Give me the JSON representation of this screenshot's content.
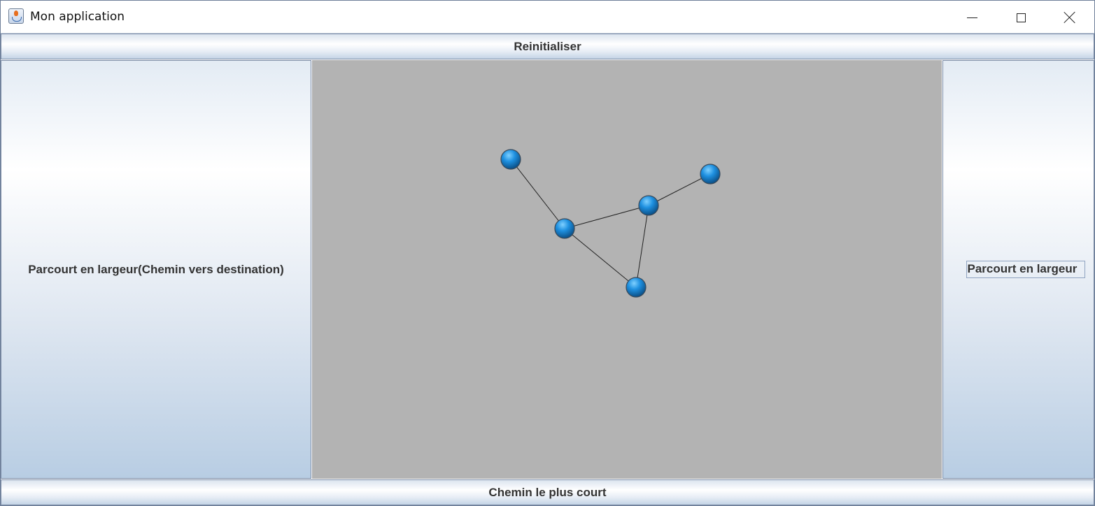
{
  "window": {
    "title": "Mon application",
    "controls": [
      "minimize-icon",
      "maximize-icon",
      "close-icon"
    ]
  },
  "buttons": {
    "top": "Reinitialiser",
    "left": "Parcourt en largeur(Chemin vers destination)",
    "right": "Parcourt en largeur",
    "bottom": "Chemin le plus court"
  },
  "graph": {
    "node_color": "#1e90e0",
    "edge_color": "#222222",
    "canvas_color": "#b3b3b3",
    "nodes": [
      {
        "id": "n1"
      },
      {
        "id": "n2"
      },
      {
        "id": "n3"
      },
      {
        "id": "n4"
      },
      {
        "id": "n5"
      }
    ],
    "edges": [
      [
        "n1",
        "n2"
      ],
      [
        "n2",
        "n3"
      ],
      [
        "n3",
        "n4"
      ],
      [
        "n2",
        "n5"
      ],
      [
        "n3",
        "n5"
      ]
    ]
  }
}
